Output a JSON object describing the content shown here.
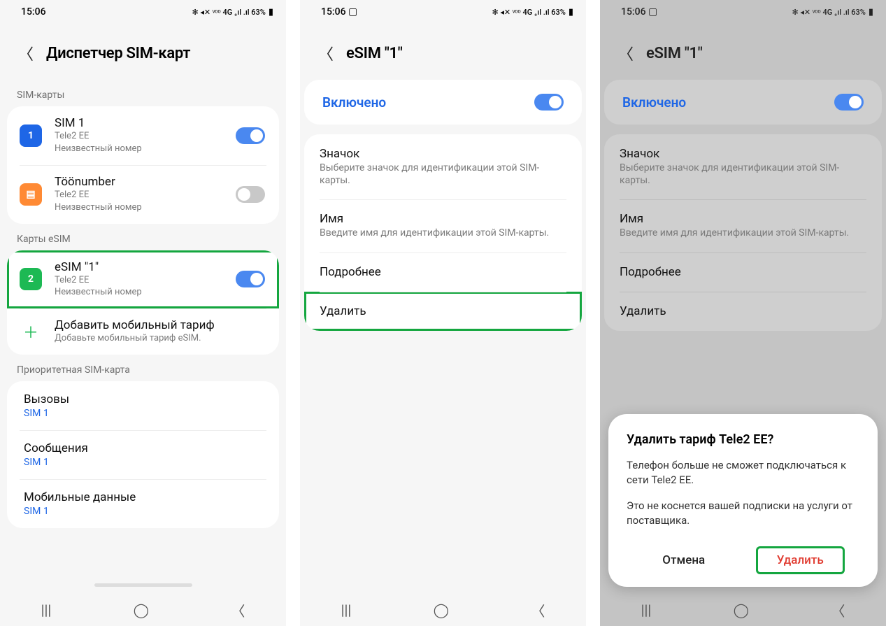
{
  "status": {
    "time": "15:06",
    "time_pic": "15:06 ▢",
    "indicators": "✻ ◂✕ ᵛᵒᵒ 4G ₊ıl .ıl 63%",
    "battery_icon": "▮"
  },
  "p1": {
    "title": "Диспетчер SIM-карт",
    "sec_sim": "SIM-карты",
    "sim1": {
      "icon": "1",
      "name": "SIM 1",
      "carrier": "Tele2 EE",
      "number": "Неизвестный номер"
    },
    "sim2": {
      "icon": "▤",
      "name": "Töönumber",
      "carrier": "Tele2 EE",
      "number": "Неизвестный номер"
    },
    "sec_esim": "Карты eSIM",
    "esim": {
      "icon": "2",
      "name": "eSIM \"1\"",
      "carrier": "Tele2 EE",
      "number": "Неизвестный номер"
    },
    "add": {
      "title": "Добавить мобильный тариф",
      "sub": "Добавьте мобильный тариф eSIM."
    },
    "sec_pref": "Приоритетная SIM-карта",
    "calls": {
      "label": "Вызовы",
      "sim": "SIM 1"
    },
    "sms": {
      "label": "Сообщения",
      "sim": "SIM 1"
    },
    "data": {
      "label": "Мобильные данные",
      "sim": "SIM 1"
    }
  },
  "p2": {
    "title": "eSIM \"1\"",
    "enabled": "Включено",
    "icon": {
      "title": "Значок",
      "sub": "Выберите значок для идентификации этой SIM-карты."
    },
    "name": {
      "title": "Имя",
      "sub": "Введите имя для идентификации этой SIM-карты."
    },
    "more": "Подробнее",
    "delete": "Удалить"
  },
  "p3": {
    "title": "eSIM \"1\"",
    "enabled": "Включено",
    "icon": {
      "title": "Значок",
      "sub": "Выберите значок для идентификации этой SIM-карты."
    },
    "name": {
      "title": "Имя",
      "sub": "Введите имя для идентификации этой SIM-карты."
    },
    "more": "Подробнее",
    "delete": "Удалить",
    "dialog": {
      "title": "Удалить тариф Tele2 EE?",
      "body1": "Телефон больше не сможет подключаться к сети Tele2 EE.",
      "body2": "Это не коснется вашей подписки на услуги от поставщика.",
      "cancel": "Отмена",
      "confirm": "Удалить"
    }
  }
}
